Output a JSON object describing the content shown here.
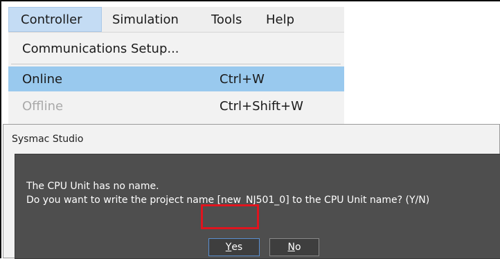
{
  "menubar": {
    "items": [
      {
        "label": "Controller"
      },
      {
        "label": "Simulation"
      },
      {
        "label": "Tools"
      },
      {
        "label": "Help"
      }
    ]
  },
  "controller_menu": {
    "items": [
      {
        "label": "Communications Setup...",
        "shortcut": ""
      },
      {
        "label": "Online",
        "shortcut": "Ctrl+W"
      },
      {
        "label": "Offline",
        "shortcut": "Ctrl+Shift+W"
      }
    ]
  },
  "dialog": {
    "title": "Sysmac Studio",
    "message_line1": "The CPU Unit has no name.",
    "message_line2": "Do you want to write the project name [new_NJ501_0] to the CPU Unit name? (Y/N)",
    "yes_mnemonic": "Y",
    "yes_rest": "es",
    "no_mnemonic": "N",
    "no_rest": "o"
  },
  "colors": {
    "highlight": "#e0141e",
    "menu_selected": "#99c9ee",
    "dialog_body": "#4e4e4e"
  }
}
